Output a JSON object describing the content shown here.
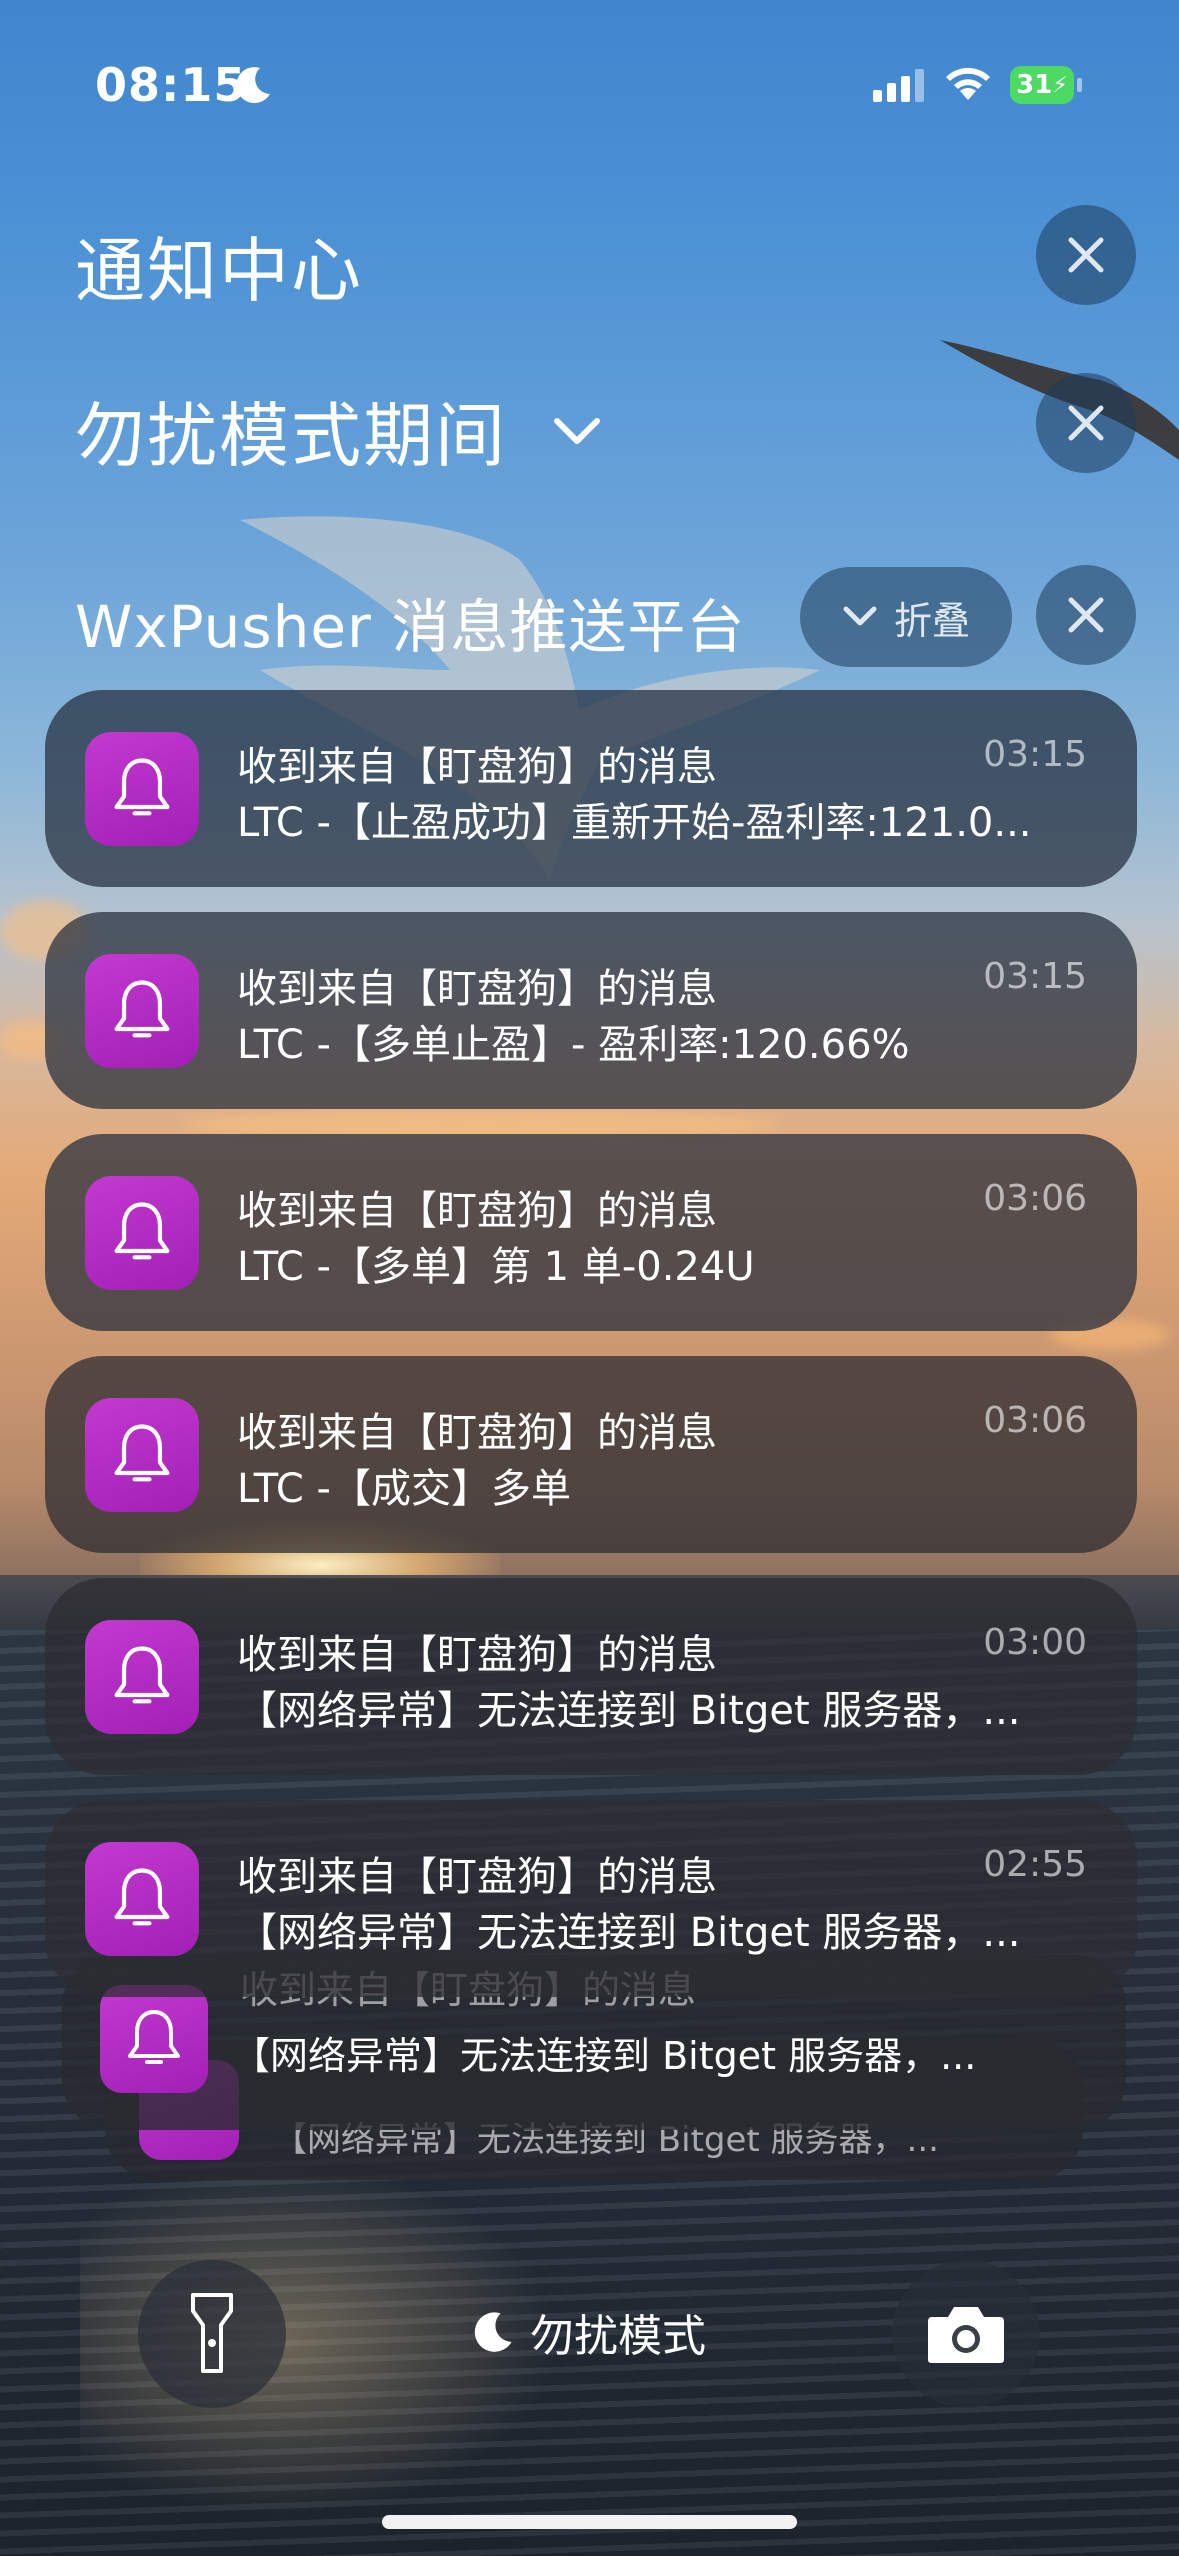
{
  "status_bar": {
    "time": "08:15",
    "battery": "31"
  },
  "header": {
    "title": "通知中心",
    "focus_mode_heading": "勿扰模式期间"
  },
  "group": {
    "app_name": "WxPusher 消息推送平台",
    "collapse_label": "折叠"
  },
  "notifications": [
    {
      "title": "收到来自【盯盘狗】的消息",
      "body": "LTC -【止盈成功】重新开始-盈利率:121.0...",
      "time": "03:15"
    },
    {
      "title": "收到来自【盯盘狗】的消息",
      "body": "LTC -【多单止盈】- 盈利率:120.66%",
      "time": "03:15"
    },
    {
      "title": "收到来自【盯盘狗】的消息",
      "body": "LTC -【多单】第 1 单-0.24U",
      "time": "03:06"
    },
    {
      "title": "收到来自【盯盘狗】的消息",
      "body": "LTC -【成交】多单",
      "time": "03:06"
    },
    {
      "title": "收到来自【盯盘狗】的消息",
      "body": "【网络异常】无法连接到 Bitget 服务器，...",
      "time": "03:00"
    },
    {
      "title": "收到来自【盯盘狗】的消息",
      "body": "【网络异常】无法连接到 Bitget 服务器，...",
      "time": "02:55"
    }
  ],
  "stacked": [
    {
      "title": "收到来自【盯盘狗】的消息",
      "body": "【网络异常】无法连接到 Bitget 服务器，..."
    },
    {
      "body": "【网络异常】无法连接到 Bitget 服务器，..."
    }
  ],
  "bottom": {
    "focus_label": "勿扰模式"
  },
  "icons": {
    "app": "bell-icon",
    "close": "close-icon",
    "flashlight": "flashlight-icon",
    "camera": "camera-icon",
    "moon": "moon-icon"
  },
  "colors": {
    "app_icon": "#b52cc6",
    "battery": "#4cd964"
  }
}
